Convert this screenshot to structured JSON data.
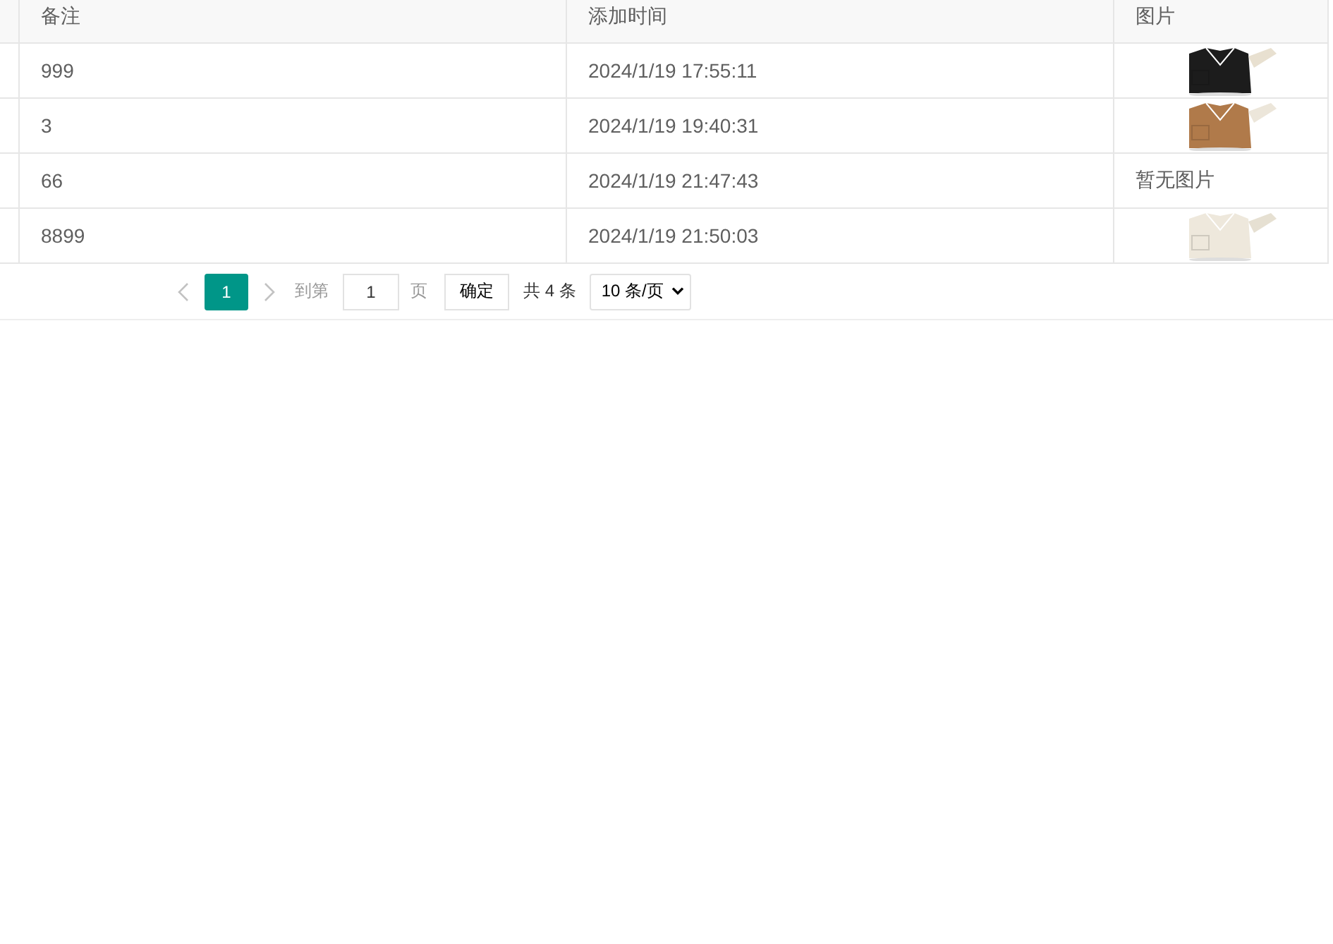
{
  "table": {
    "columns": [
      "备注",
      "添加时间",
      "图片"
    ],
    "rows": [
      {
        "note": "999",
        "time": "2024/1/19 17:55:11"
      },
      {
        "note": "3",
        "time": "2024/1/19 19:40:31"
      },
      {
        "note": "66",
        "time": "2024/1/19 21:47:43",
        "image": {
          "kind": "text",
          "text": "暂无图片"
        }
      },
      {
        "note": "8899",
        "time": "2024/1/19 21:50:03"
      }
    ]
  },
  "pagination": {
    "prev": {
      "disabled": true
    },
    "pages": [
      {
        "label": "1",
        "selected": true
      }
    ],
    "next": {
      "disabled": true
    },
    "goto_label": "到第",
    "goto_value": "1",
    "page_unit": "页",
    "confirm": "确定",
    "total": "共 4 条",
    "page_size": "10 条/页"
  }
}
